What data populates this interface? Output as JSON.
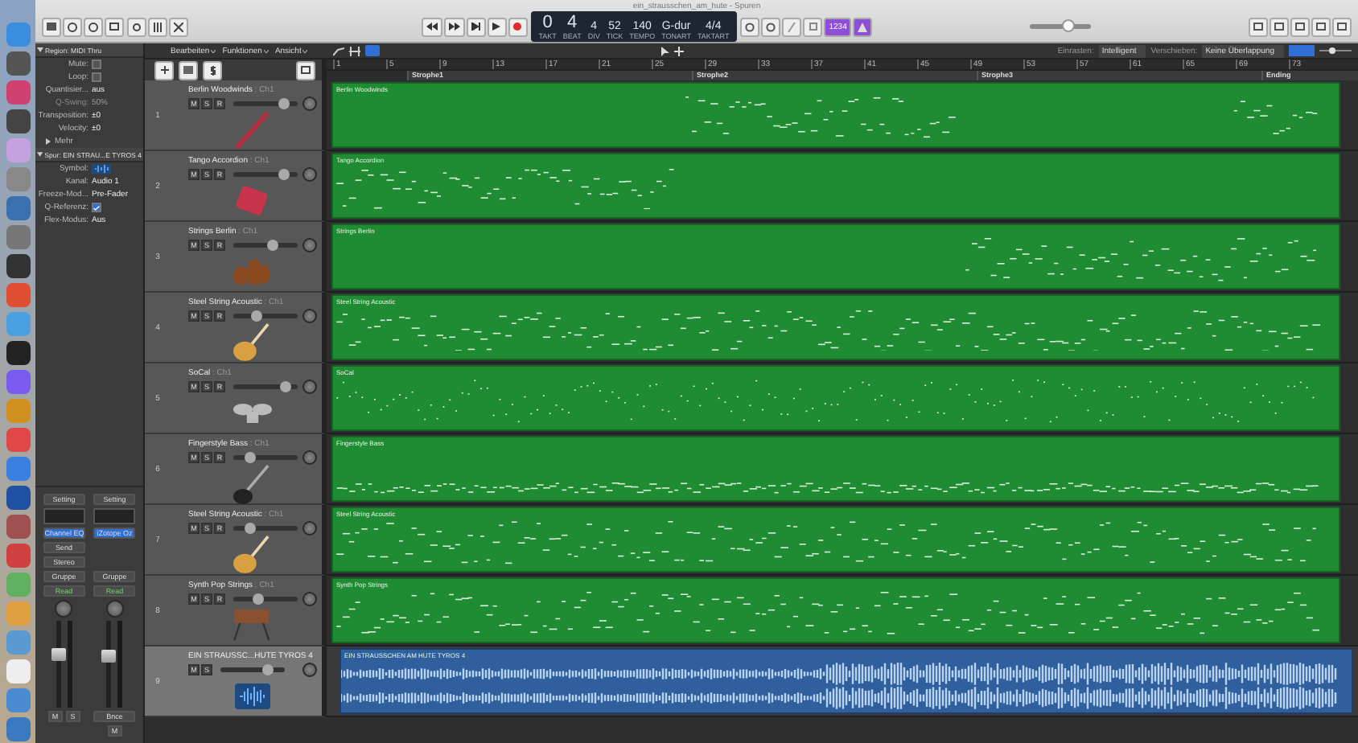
{
  "window": {
    "title": "ein_strausschen_am_hute - Spuren"
  },
  "lcd": [
    {
      "value": "0",
      "label": "TAKT",
      "big": true
    },
    {
      "value": "4",
      "label": "BEAT",
      "big": true
    },
    {
      "value": "4",
      "label": "DIV",
      "big": false
    },
    {
      "value": "52",
      "label": "TICK",
      "big": false
    },
    {
      "value": "140",
      "label": "TEMPO",
      "big": false
    },
    {
      "value": "G-dur",
      "label": "TONART",
      "big": false
    },
    {
      "value": "4/4",
      "label": "TAKTART",
      "big": false
    }
  ],
  "count_in": {
    "label": "1234",
    "on": true
  },
  "master_volume": {
    "level": 0.62
  },
  "inspector": {
    "region": {
      "title": "Region:",
      "name": "MIDI Thru",
      "expanded": true,
      "rows": [
        {
          "kind": "checkbox",
          "label": "Mute:",
          "checked": false
        },
        {
          "kind": "checkbox",
          "label": "Loop:",
          "checked": false
        },
        {
          "kind": "select",
          "label": "Quantisier...",
          "value": "aus",
          "disabled": false
        },
        {
          "kind": "select",
          "label": "Q-Swing:",
          "value": "50%",
          "disabled": true
        },
        {
          "kind": "select",
          "label": "Transposition:",
          "value": "±0",
          "disabled": false
        },
        {
          "kind": "select",
          "label": "Velocity:",
          "value": "±0",
          "disabled": false
        }
      ],
      "more": "Mehr"
    },
    "track": {
      "title": "Spur:",
      "name": "EIN STRAU...E TYROS 4",
      "expanded": true,
      "rows": [
        {
          "kind": "symbol",
          "label": "Symbol:"
        },
        {
          "kind": "select",
          "label": "Kanal:",
          "value": "Audio 1",
          "disabled": false
        },
        {
          "kind": "select",
          "label": "Freeze-Mod...",
          "value": "Pre-Fader",
          "disabled": false
        },
        {
          "kind": "checkbox",
          "label": "Q-Referenz:",
          "checked": true
        },
        {
          "kind": "select",
          "label": "Flex-Modus:",
          "value": "Aus",
          "disabled": false
        }
      ]
    },
    "strips": [
      {
        "setting": "Setting",
        "eq": "Channel EQ",
        "send": "Send",
        "output": "Stereo",
        "group": "Gruppe",
        "automation": "Read",
        "level": 0.62,
        "buttons": [
          "M",
          "S"
        ]
      },
      {
        "setting": "Setting",
        "eq": "iZotope Oz",
        "group": "Gruppe",
        "automation": "Read",
        "level": 0.6,
        "bounce": "Bnce",
        "buttons": [
          "M"
        ]
      }
    ]
  },
  "menu": [
    "Bearbeiten",
    "Funktionen",
    "Ansicht"
  ],
  "snap": {
    "label": "Einrasten:",
    "value": "Intelligent"
  },
  "drag": {
    "label": "Verschieben:",
    "value": "Keine Überlappung"
  },
  "ruler": {
    "bars": [
      "1",
      "5",
      "9",
      "13",
      "17",
      "21",
      "25",
      "29",
      "33",
      "37",
      "41",
      "45",
      "49",
      "53",
      "57",
      "61",
      "65",
      "69",
      "73"
    ],
    "markers": [
      "Strophe1",
      "Strophe2",
      "Strophe3",
      "Ending"
    ]
  },
  "tracks": [
    {
      "number": "1",
      "name": "Berlin Woodwinds",
      "channel": ": Ch1",
      "kind": "midi",
      "buttons": [
        "M",
        "S",
        "R"
      ],
      "level": 0.78,
      "selected": false,
      "region": "Berlin Woodwinds"
    },
    {
      "number": "2",
      "name": "Tango Accordion",
      "channel": ": Ch1",
      "kind": "midi",
      "buttons": [
        "M",
        "S",
        "R"
      ],
      "level": 0.78,
      "selected": false,
      "region": "Tango Accordion"
    },
    {
      "number": "3",
      "name": "Strings Berlin",
      "channel": ": Ch1",
      "kind": "midi",
      "buttons": [
        "M",
        "S",
        "R"
      ],
      "level": 0.6,
      "selected": false,
      "region": "Strings Berlin"
    },
    {
      "number": "4",
      "name": "Steel String Acoustic",
      "channel": ": Ch1",
      "kind": "midi",
      "buttons": [
        "M",
        "S",
        "R"
      ],
      "level": 0.35,
      "selected": false,
      "region": "Steel String Acoustic"
    },
    {
      "number": "5",
      "name": "SoCal",
      "channel": ": Ch1",
      "kind": "midi",
      "buttons": [
        "M",
        "S",
        "R"
      ],
      "level": 0.8,
      "selected": false,
      "region": "SoCal"
    },
    {
      "number": "6",
      "name": "Fingerstyle Bass",
      "channel": ": Ch1",
      "kind": "midi",
      "buttons": [
        "M",
        "S",
        "R"
      ],
      "level": 0.25,
      "selected": false,
      "region": "Fingerstyle Bass"
    },
    {
      "number": "7",
      "name": "Steel String Acoustic",
      "channel": ": Ch1",
      "kind": "midi",
      "buttons": [
        "M",
        "S",
        "R"
      ],
      "level": 0.25,
      "selected": false,
      "region": "Steel String Acoustic"
    },
    {
      "number": "8",
      "name": "Synth Pop Strings",
      "channel": ": Ch1",
      "kind": "midi",
      "buttons": [
        "M",
        "S",
        "R"
      ],
      "level": 0.38,
      "selected": false,
      "region": "Synth Pop Strings"
    },
    {
      "number": "9",
      "name": "EIN STRAUSSC...HUTE TYROS 4",
      "kind": "audio",
      "buttons": [
        "M",
        "S"
      ],
      "level": 0.72,
      "selected": true,
      "region": "EIN STRAUSSCHEN AM HUTE TYROS 4"
    }
  ]
}
